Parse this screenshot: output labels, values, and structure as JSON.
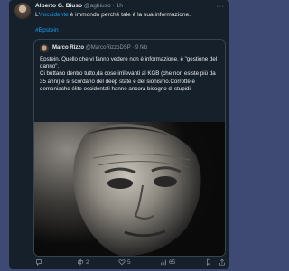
{
  "tweet": {
    "author_name": "Alberto G. Biuso",
    "handle": "@agbiuso",
    "separator": "·",
    "time": "1h",
    "text_prefix": "L'",
    "text_link": "#occidente",
    "text_rest": " è immondo perché tale è la sua informazione.",
    "hashtag": "#Epstein"
  },
  "quoted": {
    "author_name": "Marco Rizzo",
    "handle": "@MarcoRizzoDSP",
    "separator": "·",
    "time": "9 feb",
    "paragraph1": "Epstein. Quello che vi fanno vedere non è informazione, è \"gestione del danno\".",
    "paragraph2": "Ci buttano dentro tutto,da cose irrilevanti al KGB (che non esiste più da 35 anni),e si scordano del deep state e del sionismo.Corrotte e demoniache élite occidentali hanno ancora bisogno di stupidi."
  },
  "actions": {
    "reply_count": "",
    "retweet_count": "2",
    "like_count": "5",
    "views_count": "65"
  },
  "icons": [
    "more-icon",
    "reply-icon",
    "retweet-icon",
    "like-icon",
    "views-icon",
    "bookmark-icon",
    "share-icon"
  ],
  "colors": {
    "background": "#3e4a73",
    "card": "#15202b",
    "link": "#1d9bf0",
    "muted": "#8b98a5"
  }
}
